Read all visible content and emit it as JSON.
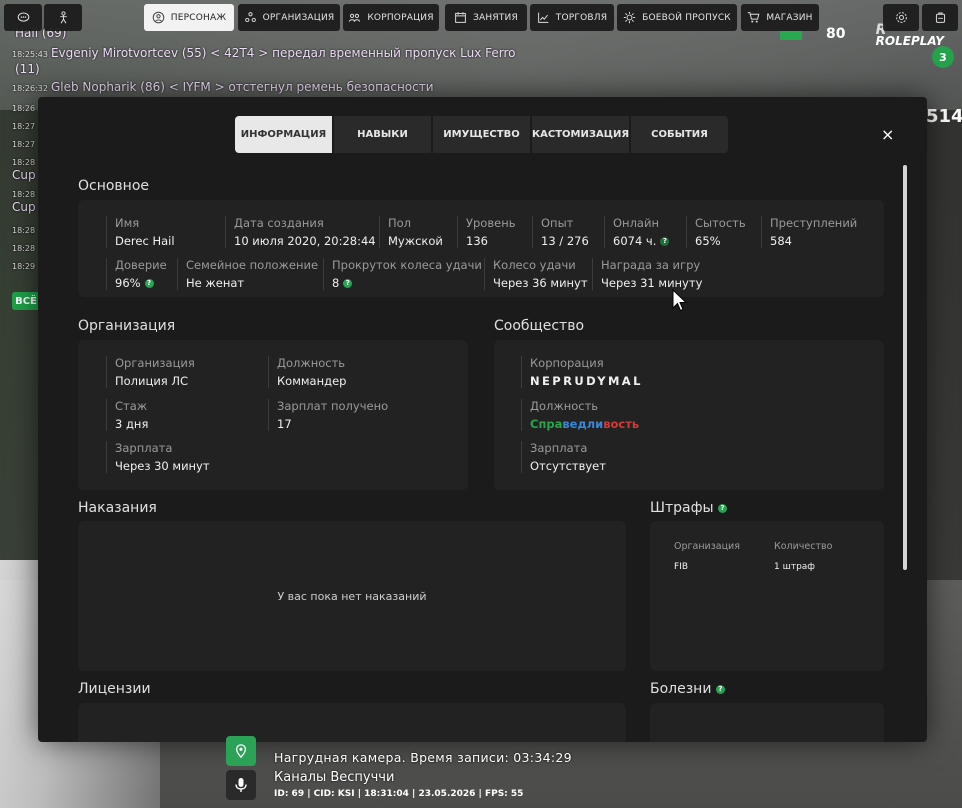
{
  "nav": [
    {
      "label": "",
      "icon": "chat-icon"
    },
    {
      "label": "",
      "icon": "figure-icon"
    },
    {
      "label": "ПЕРСОНАЖ",
      "icon": "person-icon"
    },
    {
      "label": "ОРГАНИЗАЦИЯ",
      "icon": "org-icon"
    },
    {
      "label": "КОРПОРАЦИЯ",
      "icon": "corp-icon"
    },
    {
      "label": "ЗАНЯТИЯ",
      "icon": "calendar-icon"
    },
    {
      "label": "ТОРГОВЛЯ",
      "icon": "chart-icon"
    },
    {
      "label": "БОЕВОЙ ПРОПУСК",
      "icon": "gear-badge-icon"
    },
    {
      "label": "МАГАЗИН",
      "icon": "cart-icon"
    },
    {
      "label": "",
      "icon": "settings-icon"
    },
    {
      "label": "",
      "icon": "bag-icon"
    }
  ],
  "chat": [
    {
      "time": "",
      "text": "Hail (69)"
    },
    {
      "time": "18:25:43",
      "text": "Evgeniy Mirotvortcev (55) < 42T4 > передал временный пропуск Lux Ferro"
    },
    {
      "time": "",
      "text": "(11)"
    },
    {
      "time": "18:26:32",
      "text": "Gleb Nopharik (86) < IYFM > отстегнул ремень безопасности"
    },
    {
      "time": "18:26",
      "text": ""
    },
    {
      "time": "18:27",
      "text": ""
    },
    {
      "time": "18:27",
      "text": ""
    },
    {
      "time": "18:28",
      "text": ""
    },
    {
      "time": "",
      "text": "Cup"
    },
    {
      "time": "18:28",
      "text": ""
    },
    {
      "time": "",
      "text": "Cup"
    },
    {
      "time": "18:28",
      "text": ""
    },
    {
      "time": "18:28",
      "text": ""
    },
    {
      "time": "18:28",
      "text": ""
    },
    {
      "time": "18:29",
      "text": ""
    }
  ],
  "chat_badge": "ВСЁ",
  "hud": {
    "logo_letter": "R",
    "logo": "ROLEPLAY",
    "value80": "80",
    "level": "3",
    "right_num": "514"
  },
  "tabs": [
    "ИНФОРМАЦИЯ",
    "НАВЫКИ",
    "ИМУЩЕСТВО",
    "КАСТОМИЗАЦИЯ",
    "СОБЫТИЯ"
  ],
  "close": "×",
  "sections": {
    "basic": "Основное",
    "org": "Организация",
    "community": "Сообщество",
    "punishments": "Наказания",
    "fines": "Штрафы",
    "licenses": "Лицензии",
    "diseases": "Болезни"
  },
  "basic_row1": [
    {
      "label": "Имя",
      "value": "Derec Hail"
    },
    {
      "label": "Дата создания",
      "value": "10 июля 2020, 20:28:44"
    },
    {
      "label": "Пол",
      "value": "Мужской"
    },
    {
      "label": "Уровень",
      "value": "136"
    },
    {
      "label": "Опыт",
      "value": "13 / 276"
    },
    {
      "label": "Онлайн",
      "value": "6074 ч."
    },
    {
      "label": "Сытость",
      "value": "65%"
    },
    {
      "label": "Преступлений",
      "value": "584"
    }
  ],
  "basic_row2": [
    {
      "label": "Доверие",
      "value": "96%"
    },
    {
      "label": "Семейное положение",
      "value": "Не женат"
    },
    {
      "label": "Прокруток колеса удачи",
      "value": "8"
    },
    {
      "label": "Колесо удачи",
      "value": "Через 36 минут"
    },
    {
      "label": "Награда за игру",
      "value": "Через 31 минуту"
    }
  ],
  "org_fields": {
    "org_label": "Организация",
    "org_value": "Полиция ЛС",
    "pos_label": "Должность",
    "pos_value": "Коммандер",
    "exp_label": "Стаж",
    "exp_value": "3 дня",
    "paid_label": "Зарплат получено",
    "paid_value": "17",
    "salary_label": "Зарплата",
    "salary_value": "Через 30 минут"
  },
  "community_fields": {
    "corp_label": "Корпорация",
    "corp_value": "NEPRUDYMAL",
    "pos_label": "Должность",
    "pos_a": "Спра",
    "pos_b": "ведли",
    "pos_c": "вость",
    "salary_label": "Зарплата",
    "salary_value": "Отсутствует"
  },
  "punishments_empty": "У вас пока нет наказаний",
  "fines": {
    "h_org": "Организация",
    "h_count": "Количество",
    "org": "FIB",
    "count": "1 штраф"
  },
  "bottom": {
    "camera": "Нагрудная камера. Время записи: 03:34:29",
    "channels": "Каналы Веспуччи",
    "stats": "ID: 69 | CID: KSI | 18:31:04 | 23.05.2026 | FPS: 55"
  },
  "colors": {
    "accent_green": "#27a454",
    "pos_green": "#2ba44e",
    "pos_blue": "#3a87d4",
    "pos_red": "#d13b3b"
  }
}
